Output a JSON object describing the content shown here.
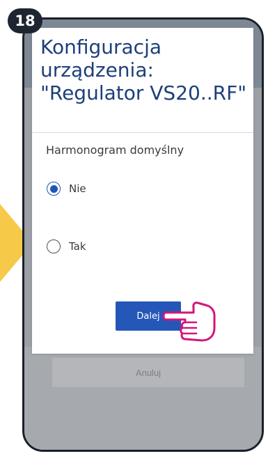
{
  "step": {
    "number": "18"
  },
  "dialog": {
    "title": "Konfiguracja urządzenia: \"Regulator VS20..RF\"",
    "field_label": "Harmonogram domyślny",
    "options": [
      {
        "label": "Nie",
        "selected": true
      },
      {
        "label": "Tak",
        "selected": false
      }
    ],
    "next_label": "Dalej"
  },
  "background": {
    "cancel_label": "Anuluj"
  },
  "colors": {
    "accent": "#2457b8",
    "title": "#1d3f7a",
    "pointer_arrow": "#f7c948",
    "hand_outline": "#d4157a"
  },
  "icons": {
    "pointer": "hand-pointer-icon",
    "side_arrow": "arrow-right-icon"
  }
}
